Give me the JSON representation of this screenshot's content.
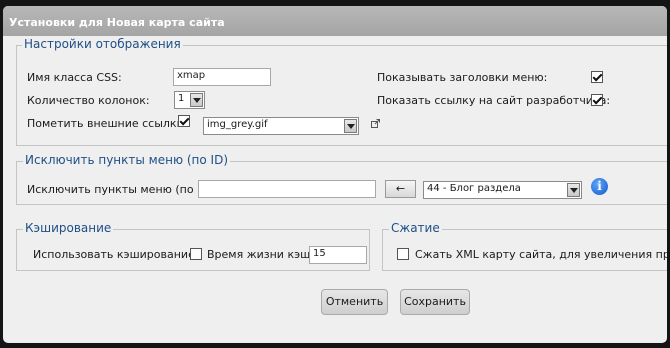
{
  "window": {
    "title": "Установки для Новая карта сайта"
  },
  "display": {
    "legend": "Настройки отображения",
    "css_class_label": "Имя класса CSS:",
    "css_class_value": "xmap",
    "columns_label": "Количество колонок:",
    "columns_value": "1",
    "external_links_label": "Пометить внешние ссылки:",
    "external_links_checked": true,
    "external_image": "img_grey.gif",
    "show_menu_titles_label": "Показывать заголовки меню:",
    "show_menu_titles_checked": true,
    "show_dev_link_label": "Показать ссылку на сайт разработчика:",
    "show_dev_link_checked": true
  },
  "exclude": {
    "legend": "Исключить пункты меню (по ID)",
    "label": "Исключить пункты меню (по ID):",
    "value": "",
    "arrow_label": "←",
    "menu_select": "44 - Блог раздела"
  },
  "cache": {
    "legend": "Кэширование",
    "use_label": "Использовать кэширование:",
    "use_checked": false,
    "lifetime_label": "Время жизни кэша:",
    "lifetime_value": "15"
  },
  "compression": {
    "legend": "Сжатие",
    "label": "Сжать XML карту сайта, для увеличения пропус",
    "checked": false
  },
  "buttons": {
    "cancel": "Отменить",
    "save": "Сохранить"
  }
}
